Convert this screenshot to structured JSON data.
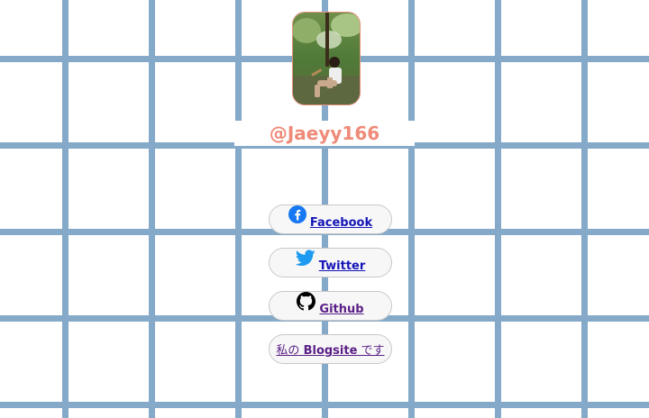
{
  "profile": {
    "handle": "@Jaeyy166",
    "avatar_icon": "profile-photo",
    "handle_color": "#ef8a78"
  },
  "links": [
    {
      "label": "Facebook",
      "icon": "facebook-icon",
      "color": "#1877f2"
    },
    {
      "label": "Twitter",
      "icon": "twitter-icon",
      "color": "#1d9bf0"
    },
    {
      "label": "Github",
      "icon": "github-icon",
      "color": "#000000"
    }
  ],
  "blog": {
    "prefix": "私の",
    "name": "Blogsite",
    "suffix": "です"
  },
  "colors": {
    "grid_line": "#85a9c8",
    "background": "#ffffff",
    "link": "#1515b8",
    "visited_link": "#5a1f86"
  }
}
